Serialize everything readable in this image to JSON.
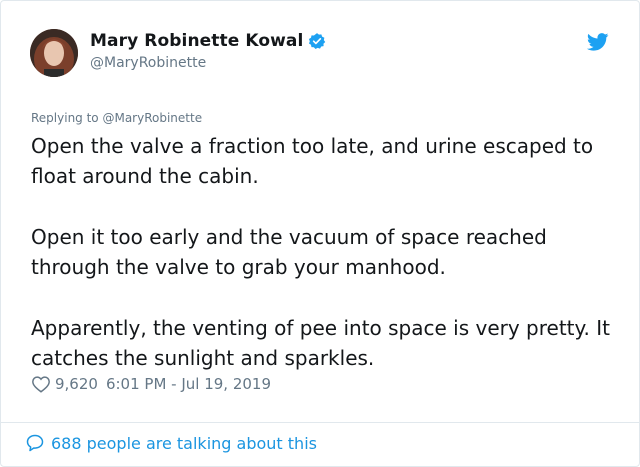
{
  "author": {
    "display_name": "Mary Robinette Kowal",
    "handle": "@MaryRobinette",
    "verified": true
  },
  "replying_to": "Replying to @MaryRobinette",
  "tweet": {
    "paragraphs": [
      "Open the valve a fraction too late, and urine escaped to float around the cabin.",
      "Open it too early and the vacuum of space reached through the valve to grab your manhood.",
      "Apparently, the venting of pee into space is very pretty. It catches the sunlight and sparkles."
    ]
  },
  "meta": {
    "likes": "9,620",
    "timestamp": "6:01 PM - Jul 19, 2019"
  },
  "footer": {
    "talking_text": "688 people are talking about this"
  },
  "icons": {
    "verified": "verified-badge-icon",
    "brand": "twitter-bird-icon",
    "like": "heart-icon",
    "reply": "speech-bubble-icon"
  },
  "colors": {
    "twitter_blue": "#1da1f2",
    "link_blue": "#1b95e0",
    "secondary_text": "#657786",
    "primary_text": "#14171a",
    "border": "#e1e8ed"
  }
}
